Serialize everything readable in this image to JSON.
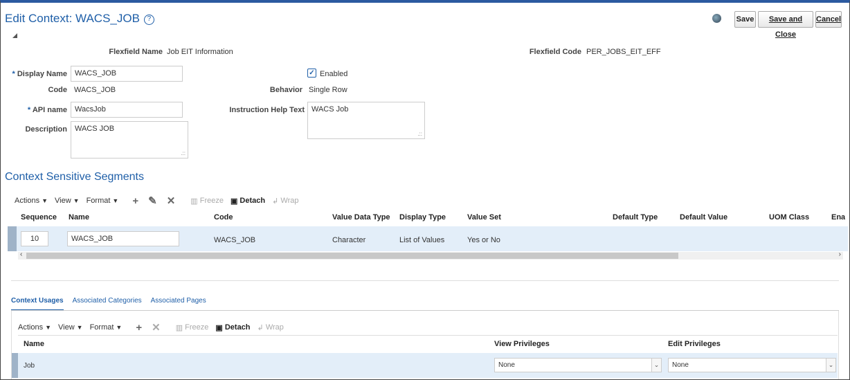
{
  "header": {
    "title": "Edit Context: WACS_JOB",
    "help_glyph": "?",
    "buttons": {
      "save": "Save",
      "save_close": "Save and Close",
      "cancel": "Cancel"
    }
  },
  "form": {
    "flexfield_name_label": "Flexfield Name",
    "flexfield_name": "Job EIT Information",
    "flexfield_code_label": "Flexfield Code",
    "flexfield_code": "PER_JOBS_EIT_EFF",
    "display_name_label": "Display Name",
    "display_name": "WACS_JOB",
    "enabled_label": "Enabled",
    "code_label": "Code",
    "code": "WACS_JOB",
    "behavior_label": "Behavior",
    "behavior": "Single Row",
    "api_name_label": "API name",
    "api_name": "WacsJob",
    "instruction_label": "Instruction Help Text",
    "instruction": "WACS Job",
    "description_label": "Description",
    "description": "WACS JOB",
    "required_mark": "*"
  },
  "segments": {
    "title": "Context Sensitive Segments",
    "toolbar": {
      "actions": "Actions",
      "view": "View",
      "format": "Format",
      "freeze": "Freeze",
      "detach": "Detach",
      "wrap": "Wrap"
    },
    "columns": [
      "Sequence",
      "Name",
      "Code",
      "Value Data Type",
      "Display Type",
      "Value Set",
      "Default Type",
      "Default Value",
      "UOM Class",
      "Ena"
    ],
    "rows": [
      {
        "sequence": "10",
        "name": "WACS_JOB",
        "code": "WACS_JOB",
        "value_data_type": "Character",
        "display_type": "List of Values",
        "value_set": "Yes or No"
      }
    ]
  },
  "usages": {
    "tabs": [
      "Context Usages",
      "Associated Categories",
      "Associated Pages"
    ],
    "toolbar": {
      "actions": "Actions",
      "view": "View",
      "format": "Format",
      "freeze": "Freeze",
      "detach": "Detach",
      "wrap": "Wrap"
    },
    "columns": [
      "Name",
      "View Privileges",
      "Edit Privileges"
    ],
    "rows": [
      {
        "name": "Job",
        "view_privileges": "None",
        "edit_privileges": "None"
      }
    ]
  }
}
